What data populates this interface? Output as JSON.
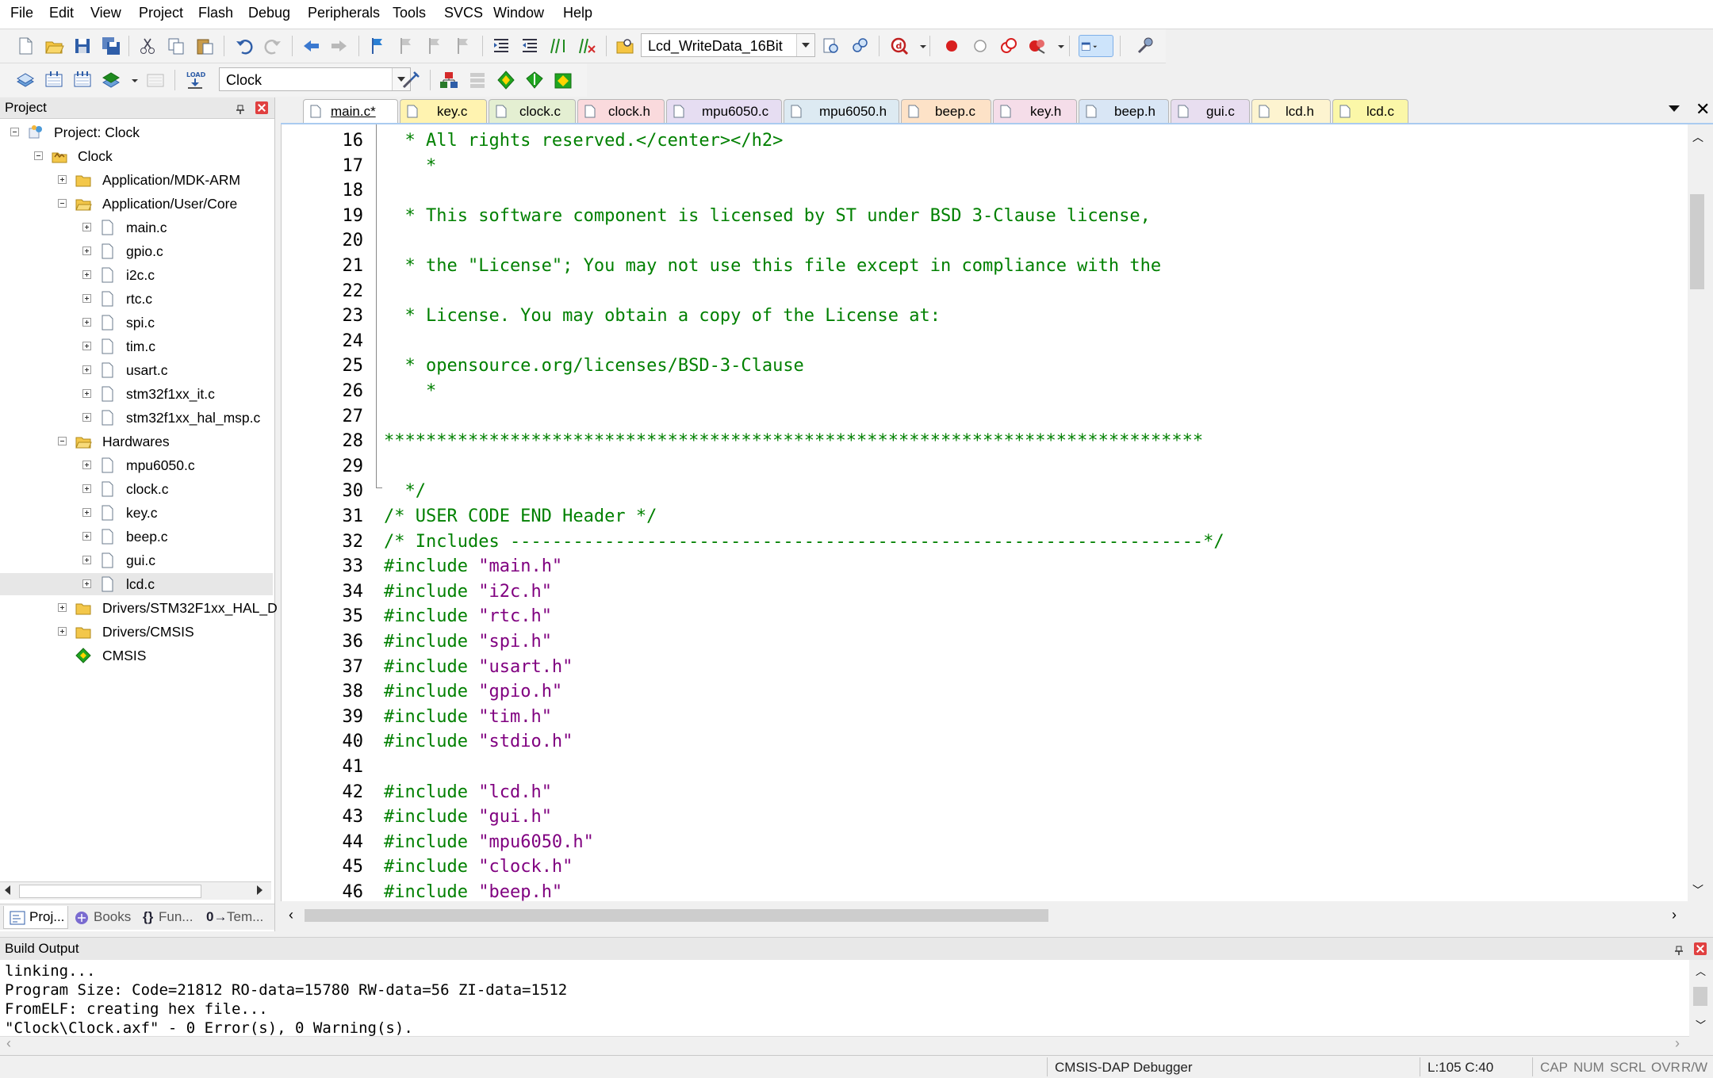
{
  "menu": [
    "File",
    "Edit",
    "View",
    "Project",
    "Flash",
    "Debug",
    "Peripherals",
    "Tools",
    "SVCS",
    "Window",
    "Help"
  ],
  "toolbar": {
    "find_combo_value": "Lcd_WriteData_16Bit",
    "target_combo_value": "Clock"
  },
  "project_panel": {
    "title": "Project",
    "tree": [
      {
        "label": "Project: Clock"
      },
      {
        "label": "Clock"
      },
      {
        "label": "Application/MDK-ARM"
      },
      {
        "label": "Application/User/Core"
      },
      {
        "label": "main.c"
      },
      {
        "label": "gpio.c"
      },
      {
        "label": "i2c.c"
      },
      {
        "label": "rtc.c"
      },
      {
        "label": "spi.c"
      },
      {
        "label": "tim.c"
      },
      {
        "label": "usart.c"
      },
      {
        "label": "stm32f1xx_it.c"
      },
      {
        "label": "stm32f1xx_hal_msp.c"
      },
      {
        "label": "Hardwares"
      },
      {
        "label": "mpu6050.c"
      },
      {
        "label": "clock.c"
      },
      {
        "label": "key.c"
      },
      {
        "label": "beep.c"
      },
      {
        "label": "gui.c"
      },
      {
        "label": "lcd.c"
      },
      {
        "label": "Drivers/STM32F1xx_HAL_D"
      },
      {
        "label": "Drivers/CMSIS"
      },
      {
        "label": "CMSIS"
      }
    ],
    "tabs": [
      "Proj...",
      "Books",
      "Fun...",
      "Tem..."
    ]
  },
  "editor_tabs": [
    {
      "label": "main.c*",
      "color": "#ffffff"
    },
    {
      "label": "key.c",
      "color": "#fff3b0"
    },
    {
      "label": "clock.c",
      "color": "#e4efd2"
    },
    {
      "label": "clock.h",
      "color": "#fadadd"
    },
    {
      "label": "mpu6050.c",
      "color": "#e6ddf2"
    },
    {
      "label": "mpu6050.h",
      "color": "#ddeaf2"
    },
    {
      "label": "beep.c",
      "color": "#fde2c7"
    },
    {
      "label": "key.h",
      "color": "#f5dde9"
    },
    {
      "label": "beep.h",
      "color": "#d9e6f5"
    },
    {
      "label": "gui.c",
      "color": "#e8def0"
    },
    {
      "label": "lcd.h",
      "color": "#fdf4d0"
    },
    {
      "label": "lcd.c",
      "color": "#fbf7a8"
    }
  ],
  "code_lines": [
    {
      "n": "16",
      "parts": [
        {
          "t": "  * All rights reserved.</center></h2>",
          "c": "cmt"
        }
      ]
    },
    {
      "n": "17",
      "parts": [
        {
          "t": "    *",
          "c": "cmt"
        }
      ]
    },
    {
      "n": "18",
      "parts": []
    },
    {
      "n": "19",
      "parts": [
        {
          "t": "  * This software component is licensed by ST under BSD 3-Clause license,",
          "c": "cmt"
        }
      ]
    },
    {
      "n": "20",
      "parts": []
    },
    {
      "n": "21",
      "parts": [
        {
          "t": "  * the \"License\"; You may not use this file except in compliance with the",
          "c": "cmt"
        }
      ]
    },
    {
      "n": "22",
      "parts": []
    },
    {
      "n": "23",
      "parts": [
        {
          "t": "  * License. You may obtain a copy of the License at:",
          "c": "cmt"
        }
      ]
    },
    {
      "n": "24",
      "parts": []
    },
    {
      "n": "25",
      "parts": [
        {
          "t": "  * opensource.org/licenses/BSD-3-Clause",
          "c": "cmt"
        }
      ]
    },
    {
      "n": "26",
      "parts": [
        {
          "t": "    *",
          "c": "cmt"
        }
      ]
    },
    {
      "n": "27",
      "parts": []
    },
    {
      "n": "28",
      "parts": [
        {
          "t": "******************************************************************************",
          "c": "cmt"
        }
      ]
    },
    {
      "n": "29",
      "parts": []
    },
    {
      "n": "30",
      "parts": [
        {
          "t": "  */",
          "c": "cmt"
        }
      ]
    },
    {
      "n": "31",
      "parts": [
        {
          "t": "/* USER CODE END Header */",
          "c": "cmt"
        }
      ]
    },
    {
      "n": "32",
      "parts": [
        {
          "t": "/* Includes ------------------------------------------------------------------*/",
          "c": "cmt"
        }
      ]
    },
    {
      "n": "33",
      "parts": [
        {
          "t": "#include ",
          "c": "pp"
        },
        {
          "t": "\"main.h\"",
          "c": "str"
        }
      ]
    },
    {
      "n": "34",
      "parts": [
        {
          "t": "#include ",
          "c": "pp"
        },
        {
          "t": "\"i2c.h\"",
          "c": "str"
        }
      ]
    },
    {
      "n": "35",
      "parts": [
        {
          "t": "#include ",
          "c": "pp"
        },
        {
          "t": "\"rtc.h\"",
          "c": "str"
        }
      ]
    },
    {
      "n": "36",
      "parts": [
        {
          "t": "#include ",
          "c": "pp"
        },
        {
          "t": "\"spi.h\"",
          "c": "str"
        }
      ]
    },
    {
      "n": "37",
      "parts": [
        {
          "t": "#include ",
          "c": "pp"
        },
        {
          "t": "\"usart.h\"",
          "c": "str"
        }
      ]
    },
    {
      "n": "38",
      "parts": [
        {
          "t": "#include ",
          "c": "pp"
        },
        {
          "t": "\"gpio.h\"",
          "c": "str"
        }
      ]
    },
    {
      "n": "39",
      "parts": [
        {
          "t": "#include ",
          "c": "pp"
        },
        {
          "t": "\"tim.h\"",
          "c": "str"
        }
      ]
    },
    {
      "n": "40",
      "parts": [
        {
          "t": "#include ",
          "c": "pp"
        },
        {
          "t": "\"stdio.h\"",
          "c": "str"
        }
      ]
    },
    {
      "n": "41",
      "parts": []
    },
    {
      "n": "42",
      "parts": [
        {
          "t": "#include ",
          "c": "pp"
        },
        {
          "t": "\"lcd.h\"",
          "c": "str"
        }
      ]
    },
    {
      "n": "43",
      "parts": [
        {
          "t": "#include ",
          "c": "pp"
        },
        {
          "t": "\"gui.h\"",
          "c": "str"
        }
      ]
    },
    {
      "n": "44",
      "parts": [
        {
          "t": "#include ",
          "c": "pp"
        },
        {
          "t": "\"mpu6050.h\"",
          "c": "str"
        }
      ]
    },
    {
      "n": "45",
      "parts": [
        {
          "t": "#include ",
          "c": "pp"
        },
        {
          "t": "\"clock.h\"",
          "c": "str"
        }
      ]
    },
    {
      "n": "46",
      "parts": [
        {
          "t": "#include ",
          "c": "pp"
        },
        {
          "t": "\"beep.h\"",
          "c": "str"
        }
      ]
    }
  ],
  "build_output": {
    "title": "Build Output",
    "lines": [
      "linking...",
      "Program Size: Code=21812 RO-data=15780 RW-data=56 ZI-data=1512",
      "FromELF: creating hex file...",
      "\"Clock\\Clock.axf\" - 0 Error(s), 0 Warning(s)."
    ]
  },
  "status": {
    "debugger": "CMSIS-DAP Debugger",
    "position": "L:105 C:40",
    "cap": "CAP",
    "num": "NUM",
    "scrl": "SCRL",
    "ovr": "OVR",
    "rw": "R/W"
  },
  "colors": {
    "comment": "#008000",
    "preprocessor": "#008000",
    "string": "#800080",
    "tab_accent": "#aacbf0"
  }
}
